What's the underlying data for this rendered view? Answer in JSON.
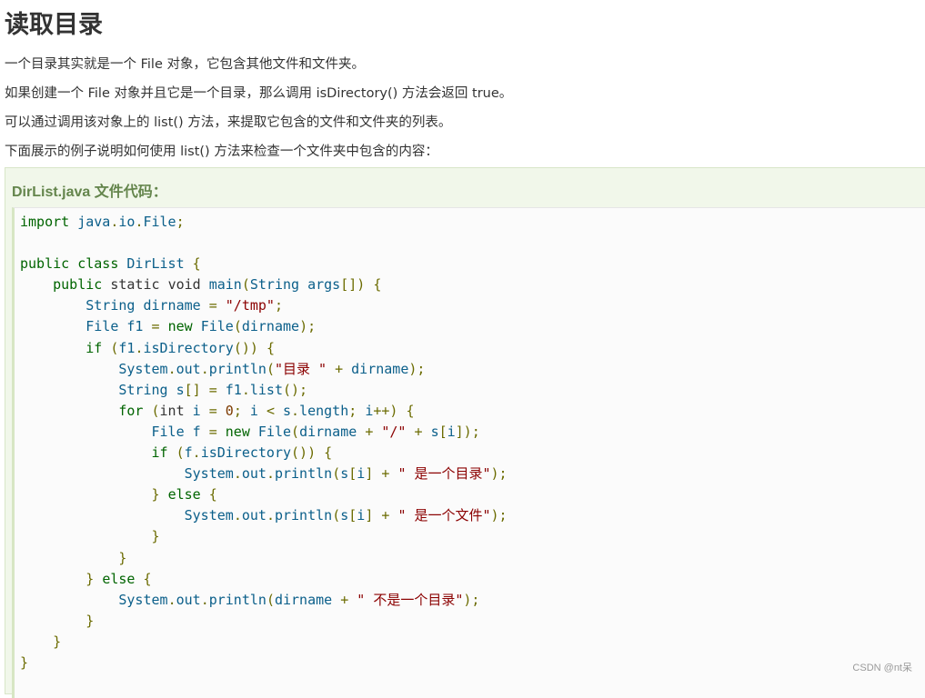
{
  "page": {
    "title": "读取目录",
    "paragraphs": [
      "一个目录其实就是一个 File 对象，它包含其他文件和文件夹。",
      "如果创建一个 File 对象并且它是一个目录，那么调用 isDirectory() 方法会返回 true。",
      "可以通过调用该对象上的 list() 方法，来提取它包含的文件和文件夹的列表。",
      "下面展示的例子说明如何使用 list() 方法来检查一个文件夹中包含的内容："
    ]
  },
  "example": {
    "title": "DirList.java 文件代码：",
    "code_lines": [
      [
        [
          "kw",
          "import"
        ],
        [
          "pln",
          " "
        ],
        [
          "id",
          "java"
        ],
        [
          "pun",
          "."
        ],
        [
          "id",
          "io"
        ],
        [
          "pun",
          "."
        ],
        [
          "id",
          "File"
        ],
        [
          "pun",
          ";"
        ]
      ],
      [],
      [
        [
          "kw",
          "public"
        ],
        [
          "pln",
          " "
        ],
        [
          "kw",
          "class"
        ],
        [
          "pln",
          " "
        ],
        [
          "id",
          "DirList"
        ],
        [
          "pln",
          " "
        ],
        [
          "pun",
          "{"
        ]
      ],
      [
        [
          "pln",
          "    "
        ],
        [
          "kw",
          "public"
        ],
        [
          "pln",
          " "
        ],
        [
          "pln",
          "static"
        ],
        [
          "pln",
          " "
        ],
        [
          "pln",
          "void"
        ],
        [
          "pln",
          " "
        ],
        [
          "id",
          "main"
        ],
        [
          "pun",
          "("
        ],
        [
          "id",
          "String"
        ],
        [
          "pln",
          " "
        ],
        [
          "id",
          "args"
        ],
        [
          "pun",
          "[])"
        ],
        [
          "pln",
          " "
        ],
        [
          "pun",
          "{"
        ]
      ],
      [
        [
          "pln",
          "        "
        ],
        [
          "id",
          "String"
        ],
        [
          "pln",
          " "
        ],
        [
          "id",
          "dirname"
        ],
        [
          "pln",
          " "
        ],
        [
          "pun",
          "="
        ],
        [
          "pln",
          " "
        ],
        [
          "str",
          "\"/tmp\""
        ],
        [
          "pun",
          ";"
        ]
      ],
      [
        [
          "pln",
          "        "
        ],
        [
          "id",
          "File"
        ],
        [
          "pln",
          " "
        ],
        [
          "id",
          "f1"
        ],
        [
          "pln",
          " "
        ],
        [
          "pun",
          "="
        ],
        [
          "pln",
          " "
        ],
        [
          "kw",
          "new"
        ],
        [
          "pln",
          " "
        ],
        [
          "id",
          "File"
        ],
        [
          "pun",
          "("
        ],
        [
          "id",
          "dirname"
        ],
        [
          "pun",
          ");"
        ]
      ],
      [
        [
          "pln",
          "        "
        ],
        [
          "kw",
          "if"
        ],
        [
          "pln",
          " "
        ],
        [
          "pun",
          "("
        ],
        [
          "id",
          "f1"
        ],
        [
          "pun",
          "."
        ],
        [
          "id",
          "isDirectory"
        ],
        [
          "pun",
          "())"
        ],
        [
          "pln",
          " "
        ],
        [
          "pun",
          "{"
        ]
      ],
      [
        [
          "pln",
          "            "
        ],
        [
          "id",
          "System"
        ],
        [
          "pun",
          "."
        ],
        [
          "id",
          "out"
        ],
        [
          "pun",
          "."
        ],
        [
          "id",
          "println"
        ],
        [
          "pun",
          "("
        ],
        [
          "str",
          "\"目录 \""
        ],
        [
          "pln",
          " "
        ],
        [
          "pun",
          "+"
        ],
        [
          "pln",
          " "
        ],
        [
          "id",
          "dirname"
        ],
        [
          "pun",
          ");"
        ]
      ],
      [
        [
          "pln",
          "            "
        ],
        [
          "id",
          "String"
        ],
        [
          "pln",
          " "
        ],
        [
          "id",
          "s"
        ],
        [
          "pun",
          "[]"
        ],
        [
          "pln",
          " "
        ],
        [
          "pun",
          "="
        ],
        [
          "pln",
          " "
        ],
        [
          "id",
          "f1"
        ],
        [
          "pun",
          "."
        ],
        [
          "id",
          "list"
        ],
        [
          "pun",
          "();"
        ]
      ],
      [
        [
          "pln",
          "            "
        ],
        [
          "kw",
          "for"
        ],
        [
          "pln",
          " "
        ],
        [
          "pun",
          "("
        ],
        [
          "pln",
          "int"
        ],
        [
          "pln",
          " "
        ],
        [
          "id",
          "i"
        ],
        [
          "pln",
          " "
        ],
        [
          "pun",
          "="
        ],
        [
          "pln",
          " "
        ],
        [
          "num",
          "0"
        ],
        [
          "pun",
          ";"
        ],
        [
          "pln",
          " "
        ],
        [
          "id",
          "i"
        ],
        [
          "pln",
          " "
        ],
        [
          "pun",
          "<"
        ],
        [
          "pln",
          " "
        ],
        [
          "id",
          "s"
        ],
        [
          "pun",
          "."
        ],
        [
          "id",
          "length"
        ],
        [
          "pun",
          ";"
        ],
        [
          "pln",
          " "
        ],
        [
          "id",
          "i"
        ],
        [
          "pun",
          "++)"
        ],
        [
          "pln",
          " "
        ],
        [
          "pun",
          "{"
        ]
      ],
      [
        [
          "pln",
          "                "
        ],
        [
          "id",
          "File"
        ],
        [
          "pln",
          " "
        ],
        [
          "id",
          "f"
        ],
        [
          "pln",
          " "
        ],
        [
          "pun",
          "="
        ],
        [
          "pln",
          " "
        ],
        [
          "kw",
          "new"
        ],
        [
          "pln",
          " "
        ],
        [
          "id",
          "File"
        ],
        [
          "pun",
          "("
        ],
        [
          "id",
          "dirname"
        ],
        [
          "pln",
          " "
        ],
        [
          "pun",
          "+"
        ],
        [
          "pln",
          " "
        ],
        [
          "str",
          "\"/\""
        ],
        [
          "pln",
          " "
        ],
        [
          "pun",
          "+"
        ],
        [
          "pln",
          " "
        ],
        [
          "id",
          "s"
        ],
        [
          "pun",
          "["
        ],
        [
          "id",
          "i"
        ],
        [
          "pun",
          "]);"
        ]
      ],
      [
        [
          "pln",
          "                "
        ],
        [
          "kw",
          "if"
        ],
        [
          "pln",
          " "
        ],
        [
          "pun",
          "("
        ],
        [
          "id",
          "f"
        ],
        [
          "pun",
          "."
        ],
        [
          "id",
          "isDirectory"
        ],
        [
          "pun",
          "())"
        ],
        [
          "pln",
          " "
        ],
        [
          "pun",
          "{"
        ]
      ],
      [
        [
          "pln",
          "                    "
        ],
        [
          "id",
          "System"
        ],
        [
          "pun",
          "."
        ],
        [
          "id",
          "out"
        ],
        [
          "pun",
          "."
        ],
        [
          "id",
          "println"
        ],
        [
          "pun",
          "("
        ],
        [
          "id",
          "s"
        ],
        [
          "pun",
          "["
        ],
        [
          "id",
          "i"
        ],
        [
          "pun",
          "]"
        ],
        [
          "pln",
          " "
        ],
        [
          "pun",
          "+"
        ],
        [
          "pln",
          " "
        ],
        [
          "str",
          "\" 是一个目录\""
        ],
        [
          "pun",
          ");"
        ]
      ],
      [
        [
          "pln",
          "                "
        ],
        [
          "pun",
          "}"
        ],
        [
          "pln",
          " "
        ],
        [
          "kw",
          "else"
        ],
        [
          "pln",
          " "
        ],
        [
          "pun",
          "{"
        ]
      ],
      [
        [
          "pln",
          "                    "
        ],
        [
          "id",
          "System"
        ],
        [
          "pun",
          "."
        ],
        [
          "id",
          "out"
        ],
        [
          "pun",
          "."
        ],
        [
          "id",
          "println"
        ],
        [
          "pun",
          "("
        ],
        [
          "id",
          "s"
        ],
        [
          "pun",
          "["
        ],
        [
          "id",
          "i"
        ],
        [
          "pun",
          "]"
        ],
        [
          "pln",
          " "
        ],
        [
          "pun",
          "+"
        ],
        [
          "pln",
          " "
        ],
        [
          "str",
          "\" 是一个文件\""
        ],
        [
          "pun",
          ");"
        ]
      ],
      [
        [
          "pln",
          "                "
        ],
        [
          "pun",
          "}"
        ]
      ],
      [
        [
          "pln",
          "            "
        ],
        [
          "pun",
          "}"
        ]
      ],
      [
        [
          "pln",
          "        "
        ],
        [
          "pun",
          "}"
        ],
        [
          "pln",
          " "
        ],
        [
          "kw",
          "else"
        ],
        [
          "pln",
          " "
        ],
        [
          "pun",
          "{"
        ]
      ],
      [
        [
          "pln",
          "            "
        ],
        [
          "id",
          "System"
        ],
        [
          "pun",
          "."
        ],
        [
          "id",
          "out"
        ],
        [
          "pun",
          "."
        ],
        [
          "id",
          "println"
        ],
        [
          "pun",
          "("
        ],
        [
          "id",
          "dirname"
        ],
        [
          "pln",
          " "
        ],
        [
          "pun",
          "+"
        ],
        [
          "pln",
          " "
        ],
        [
          "str",
          "\" 不是一个目录\""
        ],
        [
          "pun",
          ");"
        ]
      ],
      [
        [
          "pln",
          "        "
        ],
        [
          "pun",
          "}"
        ]
      ],
      [
        [
          "pln",
          "    "
        ],
        [
          "pun",
          "}"
        ]
      ],
      [
        [
          "pun",
          "}"
        ]
      ]
    ]
  },
  "watermark": "CSDN @nt呆",
  "colors": {
    "keyword": "#006400",
    "identifier": "#0b5f8a",
    "punctuation": "#6b6b00",
    "string": "#8b0000",
    "number": "#7d3a00",
    "example_title": "#64854c",
    "example_bg": "#f1f7ea"
  }
}
